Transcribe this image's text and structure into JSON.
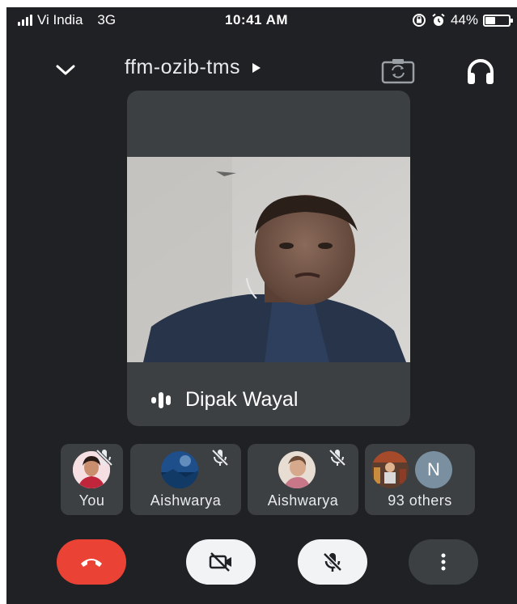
{
  "status_bar": {
    "carrier": "Vi India",
    "network": "3G",
    "time": "10:41 AM",
    "battery_percent": "44%",
    "battery_level": 0.44
  },
  "header": {
    "meeting_code": "ffm-ozib-tms",
    "icons": [
      "chevron-down-icon",
      "play-arrow-icon",
      "camera-switch-icon",
      "headphones-icon"
    ]
  },
  "main_tile": {
    "speaker_name": "Dipak Wayal"
  },
  "participants": [
    {
      "label": "You",
      "muted": true
    },
    {
      "label": "Aishwarya",
      "muted": true
    },
    {
      "label": "Aishwarya",
      "muted": true
    },
    {
      "label": "93 others",
      "initial": "N",
      "muted": false
    }
  ],
  "controls": {
    "icons": [
      "end-call-icon",
      "camera-off-icon",
      "mic-off-icon",
      "more-vert-icon"
    ]
  },
  "colors": {
    "background": "#202124",
    "tile": "#3c4043",
    "end_call": "#ea4335",
    "control_light": "#f1f3f4",
    "avatar_n": "#7a8f9f"
  }
}
